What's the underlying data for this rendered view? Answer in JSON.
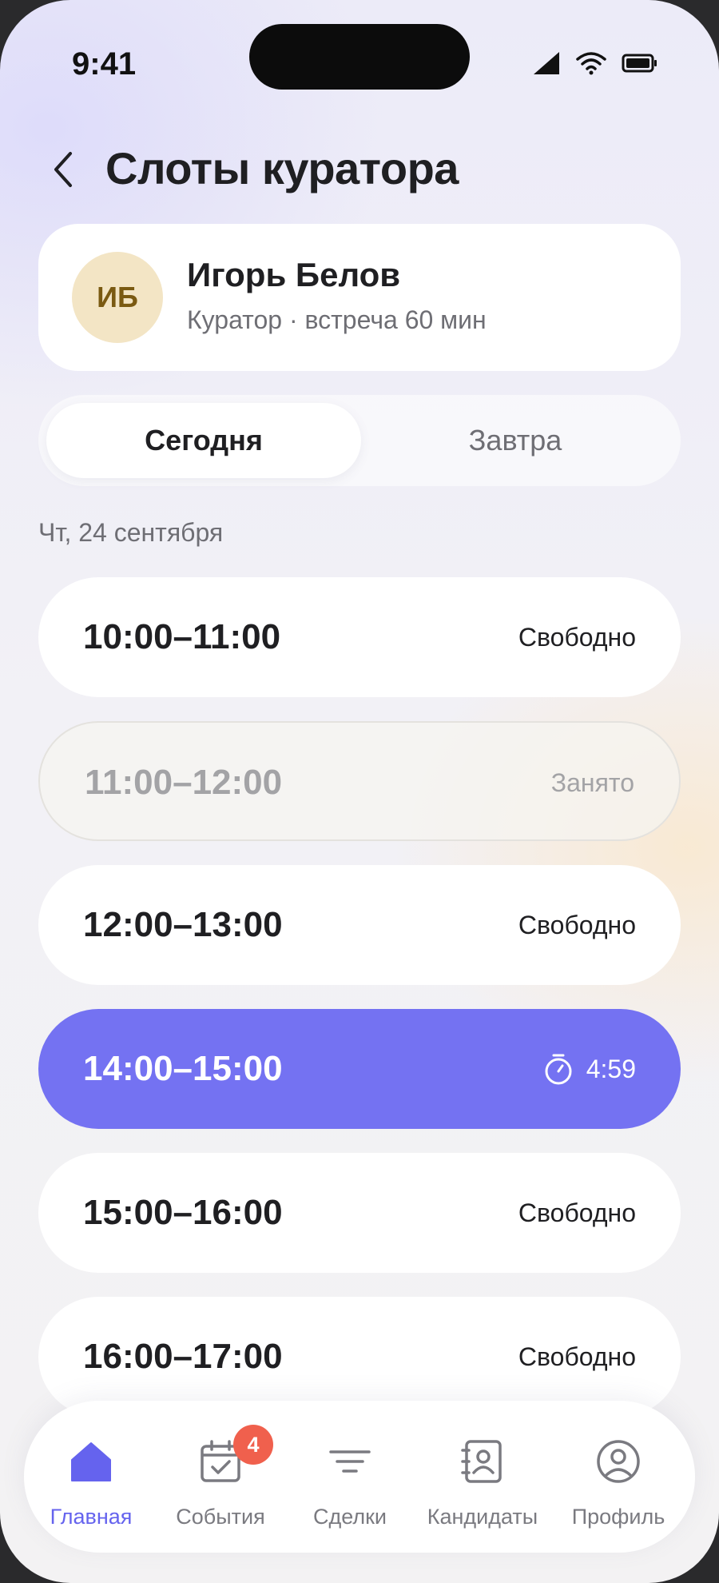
{
  "status_bar": {
    "time": "9:41"
  },
  "header": {
    "title": "Слоты куратора"
  },
  "curator": {
    "initials": "ИБ",
    "name": "Игорь Белов",
    "subtitle": "Куратор · встреча 60 мин"
  },
  "day_tabs": {
    "today": "Сегодня",
    "tomorrow": "Завтра",
    "selected": "Сегодня"
  },
  "date_label": "Чт, 24 сентября",
  "slots": [
    {
      "time": "10:00–11:00",
      "status": "Свободно"
    },
    {
      "time": "11:00–12:00",
      "status": "Занято"
    },
    {
      "time": "12:00–13:00",
      "status": "Свободно"
    },
    {
      "time": "14:00–15:00",
      "status": "4:59",
      "icon": "stopwatch-icon"
    },
    {
      "time": "15:00–16:00",
      "status": "Свободно"
    },
    {
      "time": "16:00–17:00",
      "status": "Свободно"
    }
  ],
  "tab_bar": {
    "items": [
      {
        "label": "Главная",
        "icon": "home-icon"
      },
      {
        "label": "События",
        "icon": "calendar-check-icon",
        "badge": "4"
      },
      {
        "label": "Сделки",
        "icon": "filter-icon"
      },
      {
        "label": "Кандидаты",
        "icon": "contacts-icon"
      },
      {
        "label": "Профиль",
        "icon": "profile-icon"
      }
    ],
    "active": "Главная"
  },
  "colors": {
    "accent": "#7472F2",
    "active_tab": "#6563EE",
    "badge": "#F0604D",
    "avatar_bg": "#F3E5C5"
  }
}
